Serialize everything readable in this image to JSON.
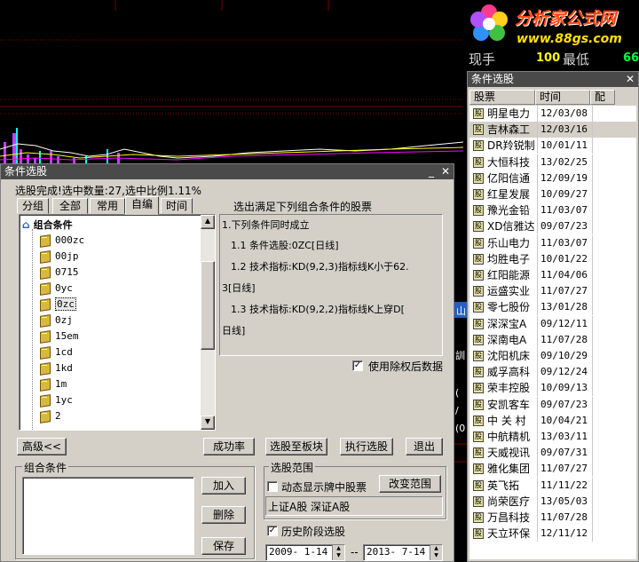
{
  "logo": {
    "title": "分析家公式网",
    "url": "www.88gs.com"
  },
  "quote": {
    "label1": "现手",
    "value1": "100",
    "label2": "最低",
    "value2": "66"
  },
  "dialog": {
    "title": "条件选股",
    "status": "选股完成!选中数量:27,选中比例1.11%",
    "tabs": [
      "分组",
      "全部",
      "常用",
      "自编",
      "时间"
    ],
    "tree_root": "组合条件",
    "tree_items": [
      "000zc",
      "00jp",
      "0715",
      "0yc",
      "0zc",
      "0zj",
      "15em",
      "1cd",
      "1kd",
      "1m",
      "1yc",
      "2"
    ],
    "criteria_title": "选出满足下列组合条件的股票",
    "criteria_lines": [
      "1.下列条件同时成立",
      "1.1 条件选股:0ZC[日线]",
      "1.2 技术指标:KD(9,2,3)指标线K小于62.",
      "3[日线]",
      "1.3 技术指标:KD(9,2,2)指标线K上穿D[",
      "日线]"
    ],
    "use_adjusted_label": "使用除权后数据",
    "buttons": {
      "advanced": "高级<<",
      "success_rate": "成功率",
      "to_sector": "选股至板块",
      "execute": "执行选股",
      "exit": "退出",
      "add": "加入",
      "delete": "删除",
      "save": "保存",
      "change_range": "改变范围"
    },
    "combo_group_label": "组合条件",
    "range_group_label": "选股范围",
    "dynamic_label": "动态显示牌中股票",
    "range_text": "上证A股 深证A股",
    "history_label": "历史阶段选股",
    "date_from": "2009- 1-14",
    "date_sep": "--",
    "date_to": "2013- 7-14"
  },
  "stock_window": {
    "title": "条件选股",
    "columns": [
      "股票",
      "时间",
      "配"
    ],
    "rows": [
      {
        "name": "明星电力",
        "date": "12/03/08"
      },
      {
        "name": "吉林森工",
        "date": "12/03/16"
      },
      {
        "name": "DR羚锐制",
        "date": "10/01/11"
      },
      {
        "name": "大恒科技",
        "date": "13/02/25"
      },
      {
        "name": "亿阳信通",
        "date": "12/09/19"
      },
      {
        "name": "红星发展",
        "date": "10/09/27"
      },
      {
        "name": "豫光金铅",
        "date": "11/03/07"
      },
      {
        "name": "XD信雅达",
        "date": "09/07/23"
      },
      {
        "name": "乐山电力",
        "date": "11/03/07"
      },
      {
        "name": "均胜电子",
        "date": "10/01/22"
      },
      {
        "name": "红阳能源",
        "date": "11/04/06"
      },
      {
        "name": "运盛实业",
        "date": "11/07/27"
      },
      {
        "name": "零七股份",
        "date": "13/01/28"
      },
      {
        "name": "深深宝A",
        "date": "09/12/11"
      },
      {
        "name": "深南电A",
        "date": "11/07/28"
      },
      {
        "name": "沈阳机床",
        "date": "09/10/29"
      },
      {
        "name": "威孚高科",
        "date": "09/12/24"
      },
      {
        "name": "荣丰控股",
        "date": "10/09/13"
      },
      {
        "name": "安凯客车",
        "date": "09/07/23"
      },
      {
        "name": "中 关 村",
        "date": "10/04/21"
      },
      {
        "name": "中航精机",
        "date": "13/03/11"
      },
      {
        "name": "天威视讯",
        "date": "09/07/31"
      },
      {
        "name": "雅化集团",
        "date": "11/07/27"
      },
      {
        "name": "英飞拓",
        "date": "11/11/22"
      },
      {
        "name": "尚荣医疗",
        "date": "13/05/03"
      },
      {
        "name": "万昌科技",
        "date": "11/07/28"
      },
      {
        "name": "天立环保",
        "date": "12/11/12"
      }
    ]
  },
  "colors": {
    "bg": "#000000",
    "window": "#d4d0c8",
    "titlebar": "#4a4a4a",
    "logo_red": "#ff4411",
    "logo_yellow": "#ffe000"
  }
}
